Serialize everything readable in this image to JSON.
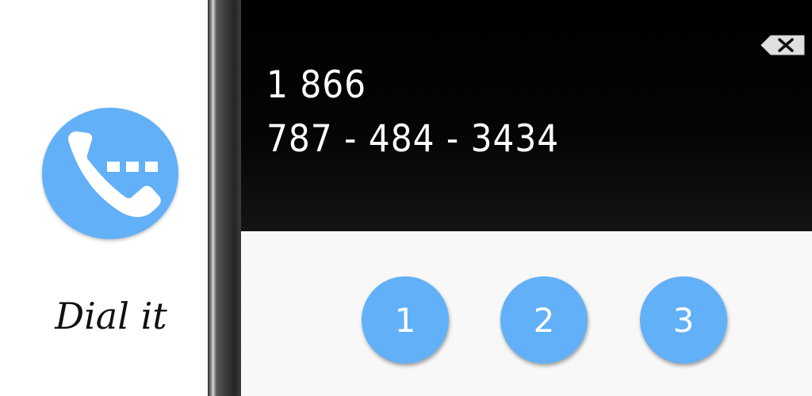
{
  "app": {
    "name": "Dial it",
    "icon": "phone-with-dots-icon",
    "accent": "#62b0f7"
  },
  "dialer": {
    "number_line1": "1 866",
    "number_line2": "787 - 484 - 3434",
    "backspace_icon": "backspace-icon",
    "keys": [
      "1",
      "2",
      "3"
    ]
  },
  "colors": {
    "display_bg": "#000000",
    "keypad_bg": "#f8f8f8",
    "key_bg": "#62b0f7"
  }
}
